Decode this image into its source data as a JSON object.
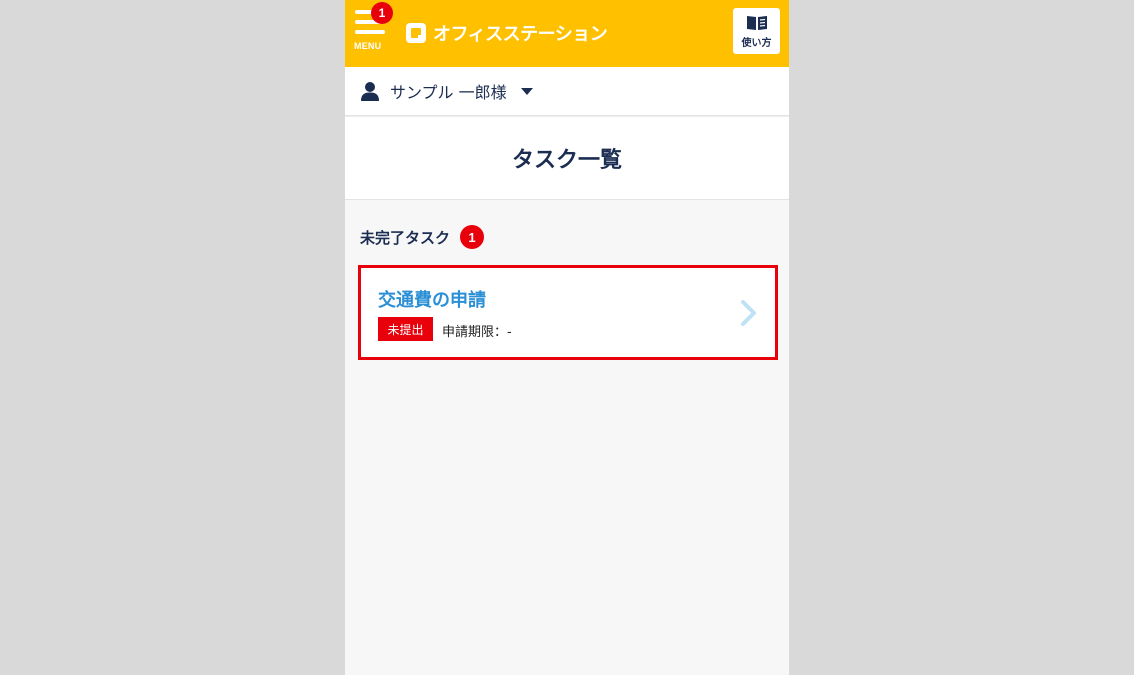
{
  "header": {
    "menu_label": "MENU",
    "menu_badge": "1",
    "brand": "オフィスステーション",
    "guide_label": "使い方",
    "accent_color": "#ffc000"
  },
  "user": {
    "name": "サンプル 一郎様"
  },
  "page": {
    "title": "タスク一覧"
  },
  "section": {
    "label": "未完了タスク",
    "count": "1"
  },
  "tasks": [
    {
      "title": "交通費の申請",
      "status": "未提出",
      "deadline": "申請期限：-"
    }
  ],
  "icons": {
    "menu": "hamburger-icon",
    "logo": "logo-icon",
    "guide": "book-icon",
    "user": "user-icon",
    "dropdown": "caret-down-icon",
    "task_link": "chevron-right-icon"
  }
}
